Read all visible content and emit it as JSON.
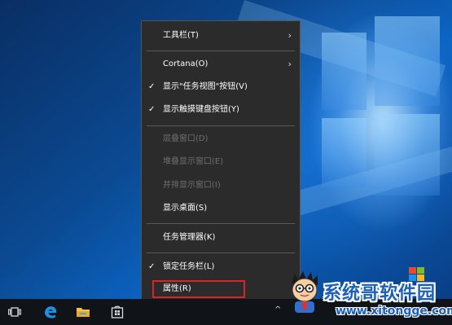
{
  "menu": {
    "items": [
      {
        "label": "工具栏(T)",
        "icon": "chevron-right-icon"
      },
      {
        "label": "Cortana(O)",
        "icon": "chevron-right-icon"
      },
      {
        "label": "显示\"任务视图\"按钮(V)",
        "checked": true
      },
      {
        "label": "显示触摸键盘按钮(Y)",
        "checked": true
      },
      {
        "label": "层叠窗口(D)",
        "disabled": true
      },
      {
        "label": "堆叠显示窗口(E)",
        "disabled": true
      },
      {
        "label": "并排显示窗口(I)",
        "disabled": true
      },
      {
        "label": "显示桌面(S)"
      },
      {
        "label": "任务管理器(K)"
      },
      {
        "label": "锁定任务栏(L)",
        "checked": true
      },
      {
        "label": "属性(R)",
        "highlighted": true
      }
    ],
    "check_glyph": "✓",
    "arrow_glyph": "›",
    "highlight_color": "#d2262a"
  },
  "taskbar": {
    "icons": [
      "task-view-icon",
      "edge-icon",
      "file-explorer-icon",
      "store-icon"
    ],
    "tray_glyph": "^"
  },
  "watermark": {
    "site_name": "系统哥软件园",
    "url": "www.xitongge.com",
    "brand_color": "#1b5fb8"
  }
}
